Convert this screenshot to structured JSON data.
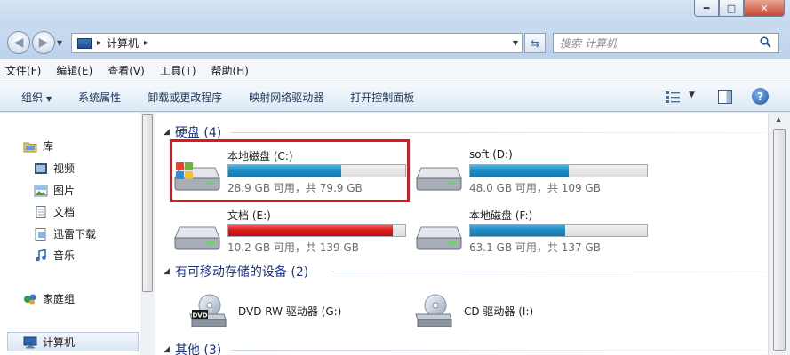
{
  "address": {
    "location": "计算机"
  },
  "search": {
    "placeholder": "搜索 计算机"
  },
  "menu": [
    "文件(F)",
    "编辑(E)",
    "查看(V)",
    "工具(T)",
    "帮助(H)"
  ],
  "commands": {
    "organize": "组织",
    "items": [
      "系统属性",
      "卸载或更改程序",
      "映射网络驱动器",
      "打开控制面板"
    ]
  },
  "sidebar": {
    "libraries": "库",
    "lib_items": [
      "视频",
      "图片",
      "文档",
      "迅雷下载",
      "音乐"
    ],
    "homegroup": "家庭组",
    "computer": "计算机"
  },
  "groups": {
    "hard_disks": "硬盘 (4)",
    "removable": "有可移动存储的设备 (2)",
    "other": "其他 (3)"
  },
  "drives": [
    {
      "name": "本地磁盘 (C:)",
      "info": "28.9 GB 可用，共 79.9 GB",
      "used_fraction": 0.64,
      "status": "normal"
    },
    {
      "name": "soft (D:)",
      "info": "48.0 GB 可用，共 109 GB",
      "used_fraction": 0.56,
      "status": "normal"
    },
    {
      "name": "文档 (E:)",
      "info": "10.2 GB 可用，共 139 GB",
      "used_fraction": 0.93,
      "status": "full"
    },
    {
      "name": "本地磁盘 (F:)",
      "info": "63.1 GB 可用，共 137 GB",
      "used_fraction": 0.54,
      "status": "normal"
    }
  ],
  "removable_devices": [
    {
      "name": "DVD RW 驱动器 (G:)",
      "icon": "dvd-drive-icon",
      "badge": "DVD"
    },
    {
      "name": "CD 驱动器 (I:)",
      "icon": "cd-drive-icon"
    }
  ],
  "colors": {
    "bar_normal": "#1e8cc8",
    "bar_full": "#de1b1b",
    "highlight": "#e2141d",
    "group_text": "#1e3287"
  }
}
